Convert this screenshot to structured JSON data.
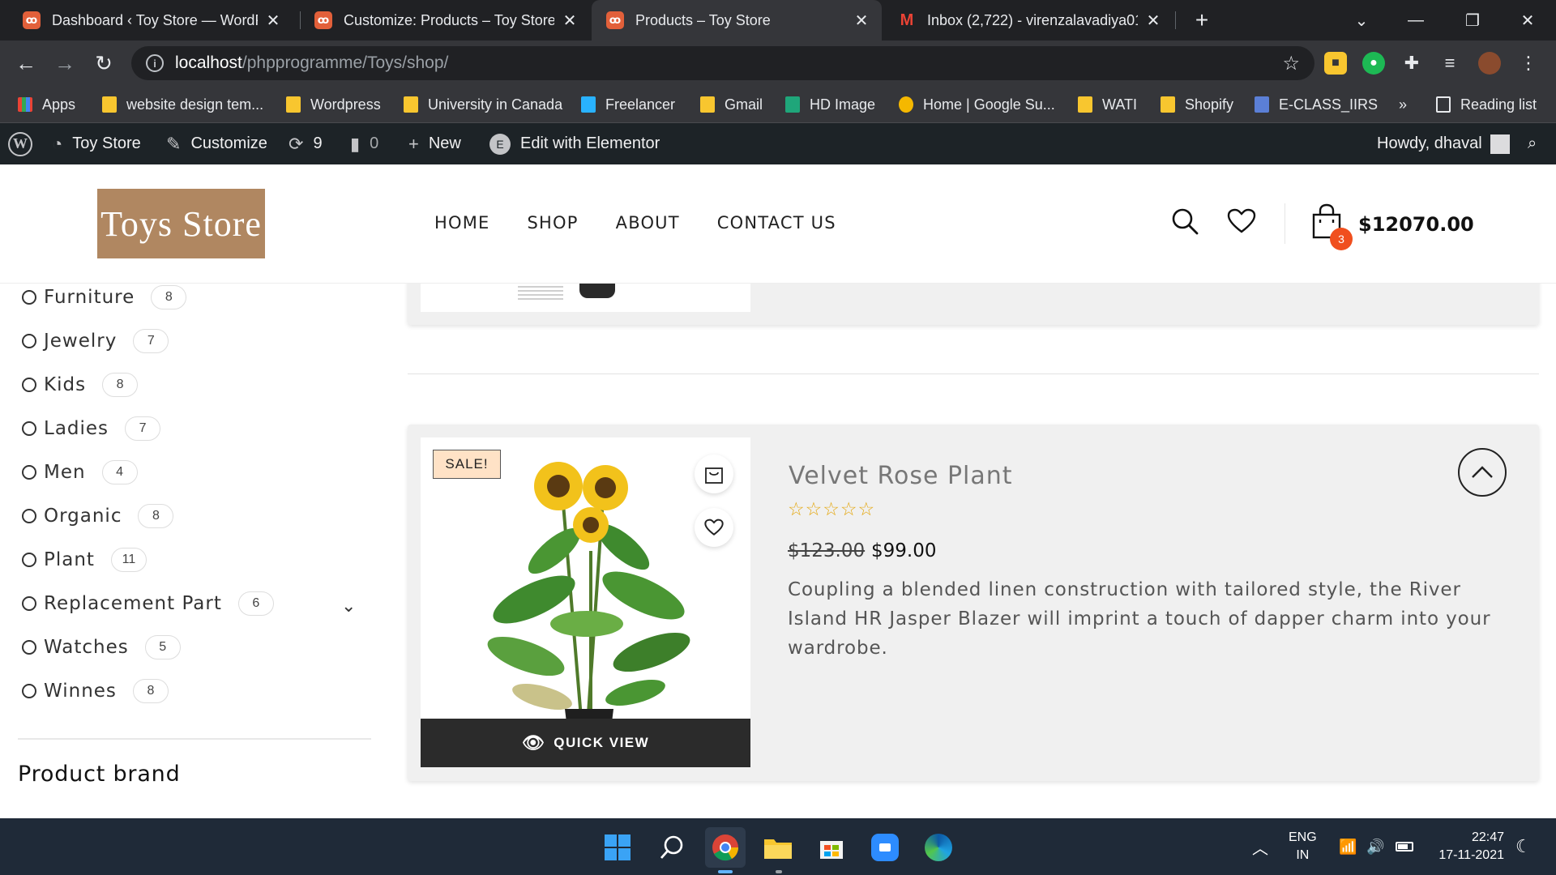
{
  "browser": {
    "tabs": [
      {
        "title": "Dashboard ‹ Toy Store — WordPr",
        "icon": "xampp-icon",
        "active": false
      },
      {
        "title": "Customize: Products – Toy Store",
        "icon": "xampp-icon",
        "active": false
      },
      {
        "title": "Products – Toy Store",
        "icon": "xampp-icon",
        "active": true
      },
      {
        "title": "Inbox (2,722) - virenzalavadiya01",
        "icon": "gmail-icon",
        "active": false
      }
    ],
    "new_tab_label": "+",
    "url_host": "localhost",
    "url_path": "/phpprogramme/Toys/shop/",
    "bookmarks": [
      {
        "label": "Apps",
        "icon": "apps-grid-icon"
      },
      {
        "label": "website design tem...",
        "icon": "folder-icon"
      },
      {
        "label": "Wordpress",
        "icon": "folder-icon"
      },
      {
        "label": "University in Canada",
        "icon": "folder-icon"
      },
      {
        "label": "Freelancer",
        "icon": "freelancer-icon"
      },
      {
        "label": "Gmail",
        "icon": "folder-icon"
      },
      {
        "label": "HD Image",
        "icon": "hd-image-icon"
      },
      {
        "label": "Home | Google Su...",
        "icon": "sun-icon"
      },
      {
        "label": "WATI",
        "icon": "folder-icon"
      },
      {
        "label": "Shopify",
        "icon": "folder-icon"
      },
      {
        "label": "E-CLASS_IIRS",
        "icon": "iirs-icon"
      }
    ],
    "bookmarks_overflow": "»",
    "reading_list": "Reading list"
  },
  "admin_bar": {
    "site_name": "Toy Store",
    "customize": "Customize",
    "updates_count": "9",
    "comments_count": "0",
    "new_label": "New",
    "elementor": "Edit with Elementor",
    "howdy": "Howdy, dhaval"
  },
  "header": {
    "logo_text": "Toys Store",
    "nav": [
      "HOME",
      "SHOP",
      "ABOUT",
      "CONTACT US"
    ],
    "cart_count": "3",
    "cart_total": "$12070.00"
  },
  "sidebar": {
    "categories": [
      {
        "name": "Furniture",
        "count": "8"
      },
      {
        "name": "Jewelry",
        "count": "7"
      },
      {
        "name": "Kids",
        "count": "8"
      },
      {
        "name": "Ladies",
        "count": "7"
      },
      {
        "name": "Men",
        "count": "4"
      },
      {
        "name": "Organic",
        "count": "8"
      },
      {
        "name": "Plant",
        "count": "11"
      },
      {
        "name": "Replacement Part",
        "count": "6"
      },
      {
        "name": "Watches",
        "count": "5"
      },
      {
        "name": "Winnes",
        "count": "8"
      }
    ],
    "brand_heading": "Product brand"
  },
  "product": {
    "sale_badge": "SALE!",
    "name": "Velvet Rose Plant",
    "rating": 0,
    "old_price": "$123.00",
    "new_price": "$99.00",
    "description": "Coupling a blended linen construction with tailored style, the River Island HR Jasper Blazer will imprint a touch of dapper charm into your wardrobe.",
    "quick_view": "QUICK VIEW"
  },
  "taskbar": {
    "lang_1": "ENG",
    "lang_2": "IN",
    "time": "22:47",
    "date": "17-11-2021"
  },
  "colors": {
    "accent": "#f04f1e",
    "logo_bg": "#b08761",
    "star": "#e4a70f"
  }
}
